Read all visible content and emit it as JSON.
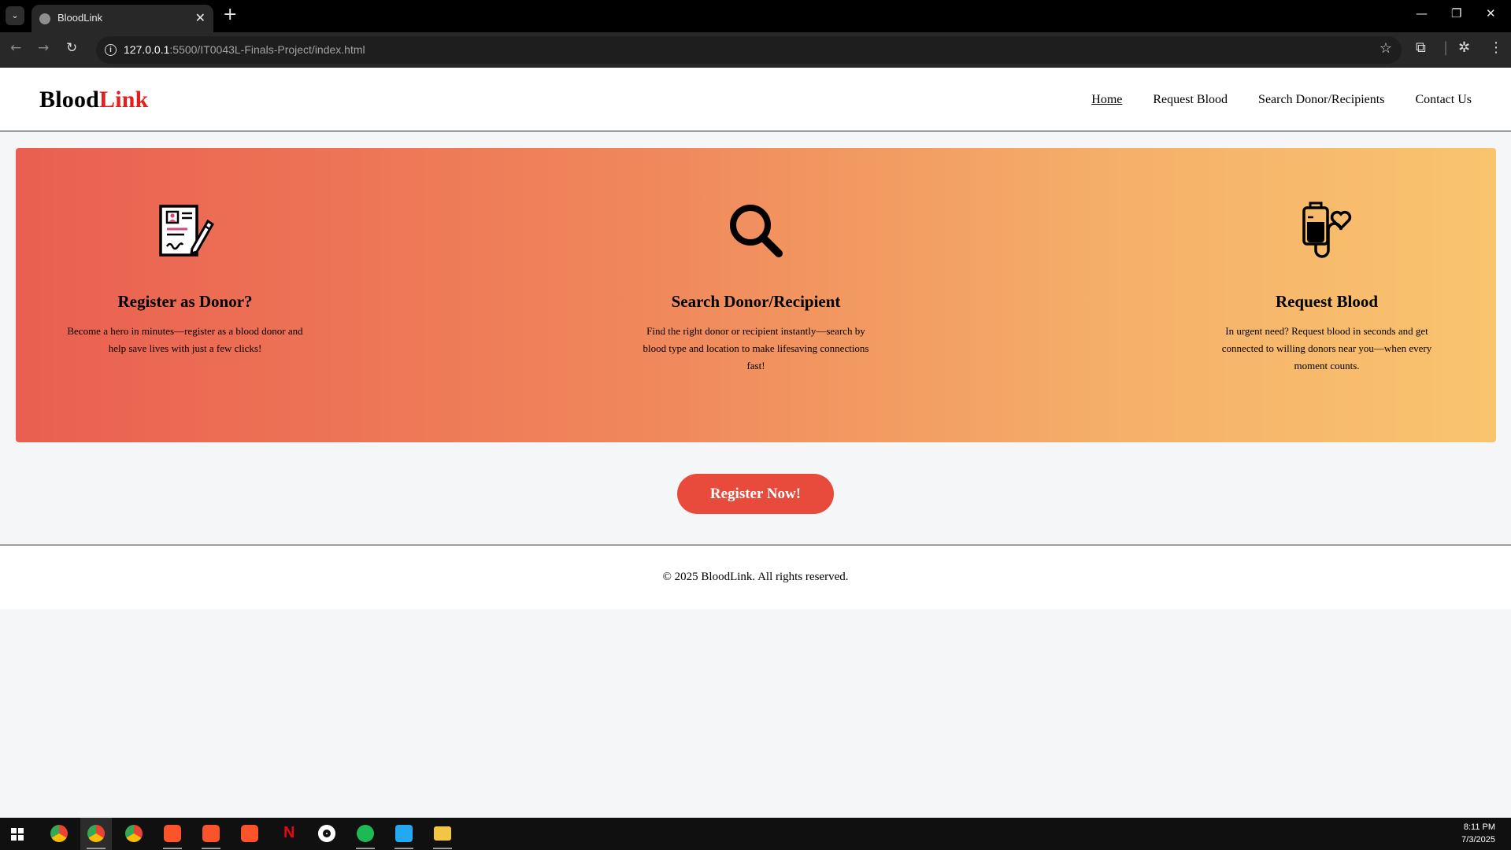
{
  "browser": {
    "tab_title": "BloodLink",
    "url_host": "127.0.0.1",
    "url_path": ":5500/IT0043L-Finals-Project/index.html"
  },
  "header": {
    "logo_part1": "Blood",
    "logo_part2": "Link",
    "nav": [
      "Home",
      "Request Blood",
      "Search Donor/Recipients",
      "Contact Us"
    ],
    "active_nav": "Home"
  },
  "cards": [
    {
      "icon": "registration-form-icon",
      "title": "Register as Donor?",
      "description": "Become a hero in minutes—register as a blood donor and help save lives with just a few clicks!"
    },
    {
      "icon": "magnifier-icon",
      "title": "Search Donor/Recipient",
      "description": "Find the right donor or recipient instantly—search by blood type and location to make lifesaving connections fast!"
    },
    {
      "icon": "blood-bag-icon",
      "title": "Request Blood",
      "description": "In urgent need? Request blood in seconds and get connected to willing donors near you—when every moment counts."
    }
  ],
  "cta": {
    "label": "Register Now!"
  },
  "footer": {
    "copyright": "© 2025 BloodLink. All rights reserved."
  },
  "taskbar": {
    "time": "8:11 PM",
    "date": "7/3/2025",
    "apps": [
      "chrome",
      "chrome",
      "chrome",
      "brave",
      "brave",
      "brave",
      "netflix",
      "media-player",
      "spotify",
      "vscode",
      "file-explorer"
    ]
  },
  "colors": {
    "accent_red": "#e41d1d",
    "button_red": "#e84a3b",
    "gradient_start": "#ea5f50",
    "gradient_end": "#f9c46e"
  }
}
